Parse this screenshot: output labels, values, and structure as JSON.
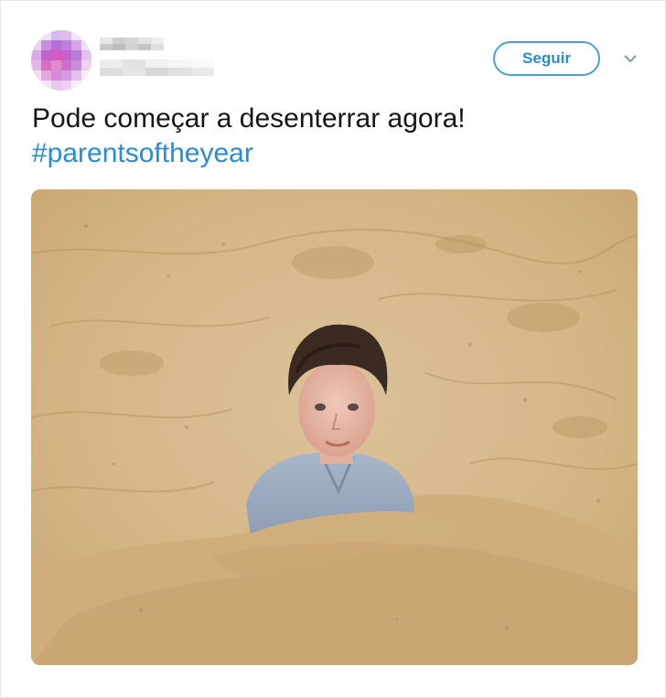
{
  "tweet": {
    "follow_label": "Seguir",
    "text": "Pode começar a desenterrar agora!",
    "hashtag": "#parentsoftheyear"
  },
  "icons": {
    "caret": "chevron-down-icon",
    "avatar": "avatar-pixelated"
  },
  "colors": {
    "accent": "#2b8bcf",
    "border": "#e1e8ed",
    "text": "#14171a",
    "sand": "#d8bb8f"
  }
}
